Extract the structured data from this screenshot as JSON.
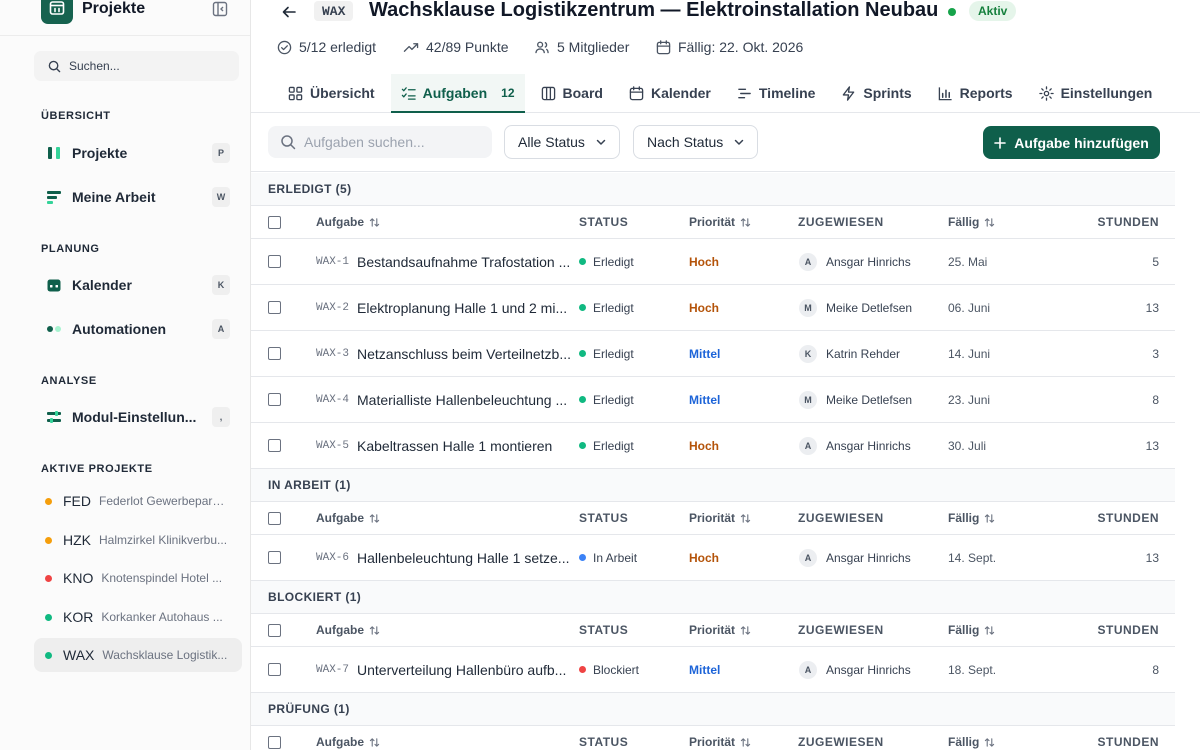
{
  "sidebar": {
    "title": "Projekte",
    "search_placeholder": "Suchen...",
    "sections": {
      "overview": "ÜBERSICHT",
      "planning": "PLANUNG",
      "analysis": "ANALYSE",
      "active_projects": "AKTIVE PROJEKTE"
    },
    "items": [
      {
        "label": "Projekte",
        "key": "P"
      },
      {
        "label": "Meine Arbeit",
        "key": "W"
      },
      {
        "label": "Kalender",
        "key": "K"
      },
      {
        "label": "Automationen",
        "key": "A"
      },
      {
        "label": "Modul-Einstellun...",
        "key": ","
      }
    ],
    "projects": [
      {
        "code": "FED",
        "name": "Federlot Gewerbepark ...",
        "color": "#f59e0b"
      },
      {
        "code": "HZK",
        "name": "Halmzirkel Klinikverbu...",
        "color": "#f59e0b"
      },
      {
        "code": "KNO",
        "name": "Knotenspindel Hotel ...",
        "color": "#ef4444"
      },
      {
        "code": "KOR",
        "name": "Korkanker Autohaus ...",
        "color": "#10b981"
      },
      {
        "code": "WAX",
        "name": "Wachsklause Logistik...",
        "color": "#10b981"
      }
    ]
  },
  "header": {
    "code": "WAX",
    "title": "Wachsklause Logistikzentrum — Elektroinstallation Neubau",
    "status": "Aktiv",
    "meta": {
      "done": "5/12 erledigt",
      "points": "42/89 Punkte",
      "members": "5 Mitglieder",
      "due": "Fällig: 22. Okt. 2026"
    },
    "tabs": [
      {
        "label": "Übersicht"
      },
      {
        "label": "Aufgaben",
        "count": "12"
      },
      {
        "label": "Board"
      },
      {
        "label": "Kalender"
      },
      {
        "label": "Timeline"
      },
      {
        "label": "Sprints"
      },
      {
        "label": "Reports"
      },
      {
        "label": "Einstellungen"
      }
    ]
  },
  "toolbar": {
    "search_placeholder": "Aufgaben suchen...",
    "filter_status": "Alle Status",
    "group_by": "Nach Status",
    "add_button": "Aufgabe hinzufügen"
  },
  "columns": {
    "task": "Aufgabe",
    "status": "STATUS",
    "priority": "Priorität",
    "assignee": "ZUGEWIESEN",
    "due": "Fällig",
    "hours": "STUNDEN"
  },
  "colors": {
    "accent": "#0f5f4b",
    "prio_high": "#b45309",
    "prio_medium": "#1d64d8",
    "status_done": "#10b981",
    "status_in_progress": "#3b82f6",
    "status_blocked": "#ef4444"
  },
  "groups": [
    {
      "label": "ERLEDIGT (5)",
      "tasks": [
        {
          "key": "WAX-1",
          "title": "Bestandsaufnahme Trafostation ...",
          "status": "Erledigt",
          "status_color": "#10b981",
          "priority": "Hoch",
          "priority_color": "#b45309",
          "initial": "A",
          "assignee": "Ansgar Hinrichs",
          "due": "25. Mai",
          "hours": "5"
        },
        {
          "key": "WAX-2",
          "title": "Elektroplanung Halle 1 und 2 mi...",
          "status": "Erledigt",
          "status_color": "#10b981",
          "priority": "Hoch",
          "priority_color": "#b45309",
          "initial": "M",
          "assignee": "Meike Detlefsen",
          "due": "06. Juni",
          "hours": "13"
        },
        {
          "key": "WAX-3",
          "title": "Netzanschluss beim Verteilnetzb...",
          "status": "Erledigt",
          "status_color": "#10b981",
          "priority": "Mittel",
          "priority_color": "#1d64d8",
          "initial": "K",
          "assignee": "Katrin Rehder",
          "due": "14. Juni",
          "hours": "3"
        },
        {
          "key": "WAX-4",
          "title": "Materialliste Hallenbeleuchtung ...",
          "status": "Erledigt",
          "status_color": "#10b981",
          "priority": "Mittel",
          "priority_color": "#1d64d8",
          "initial": "M",
          "assignee": "Meike Detlefsen",
          "due": "23. Juni",
          "hours": "8"
        },
        {
          "key": "WAX-5",
          "title": "Kabeltrassen Halle 1 montieren",
          "status": "Erledigt",
          "status_color": "#10b981",
          "priority": "Hoch",
          "priority_color": "#b45309",
          "initial": "A",
          "assignee": "Ansgar Hinrichs",
          "due": "30. Juli",
          "hours": "13"
        }
      ]
    },
    {
      "label": "IN ARBEIT (1)",
      "tasks": [
        {
          "key": "WAX-6",
          "title": "Hallenbeleuchtung Halle 1 setze...",
          "status": "In Arbeit",
          "status_color": "#3b82f6",
          "priority": "Hoch",
          "priority_color": "#b45309",
          "initial": "A",
          "assignee": "Ansgar Hinrichs",
          "due": "14. Sept.",
          "hours": "13"
        }
      ]
    },
    {
      "label": "BLOCKIERT (1)",
      "tasks": [
        {
          "key": "WAX-7",
          "title": "Unterverteilung Hallenbüro aufb...",
          "status": "Blockiert",
          "status_color": "#ef4444",
          "priority": "Mittel",
          "priority_color": "#1d64d8",
          "initial": "A",
          "assignee": "Ansgar Hinrichs",
          "due": "18. Sept.",
          "hours": "8"
        }
      ]
    },
    {
      "label": "PRÜFUNG (1)",
      "tasks": []
    }
  ]
}
